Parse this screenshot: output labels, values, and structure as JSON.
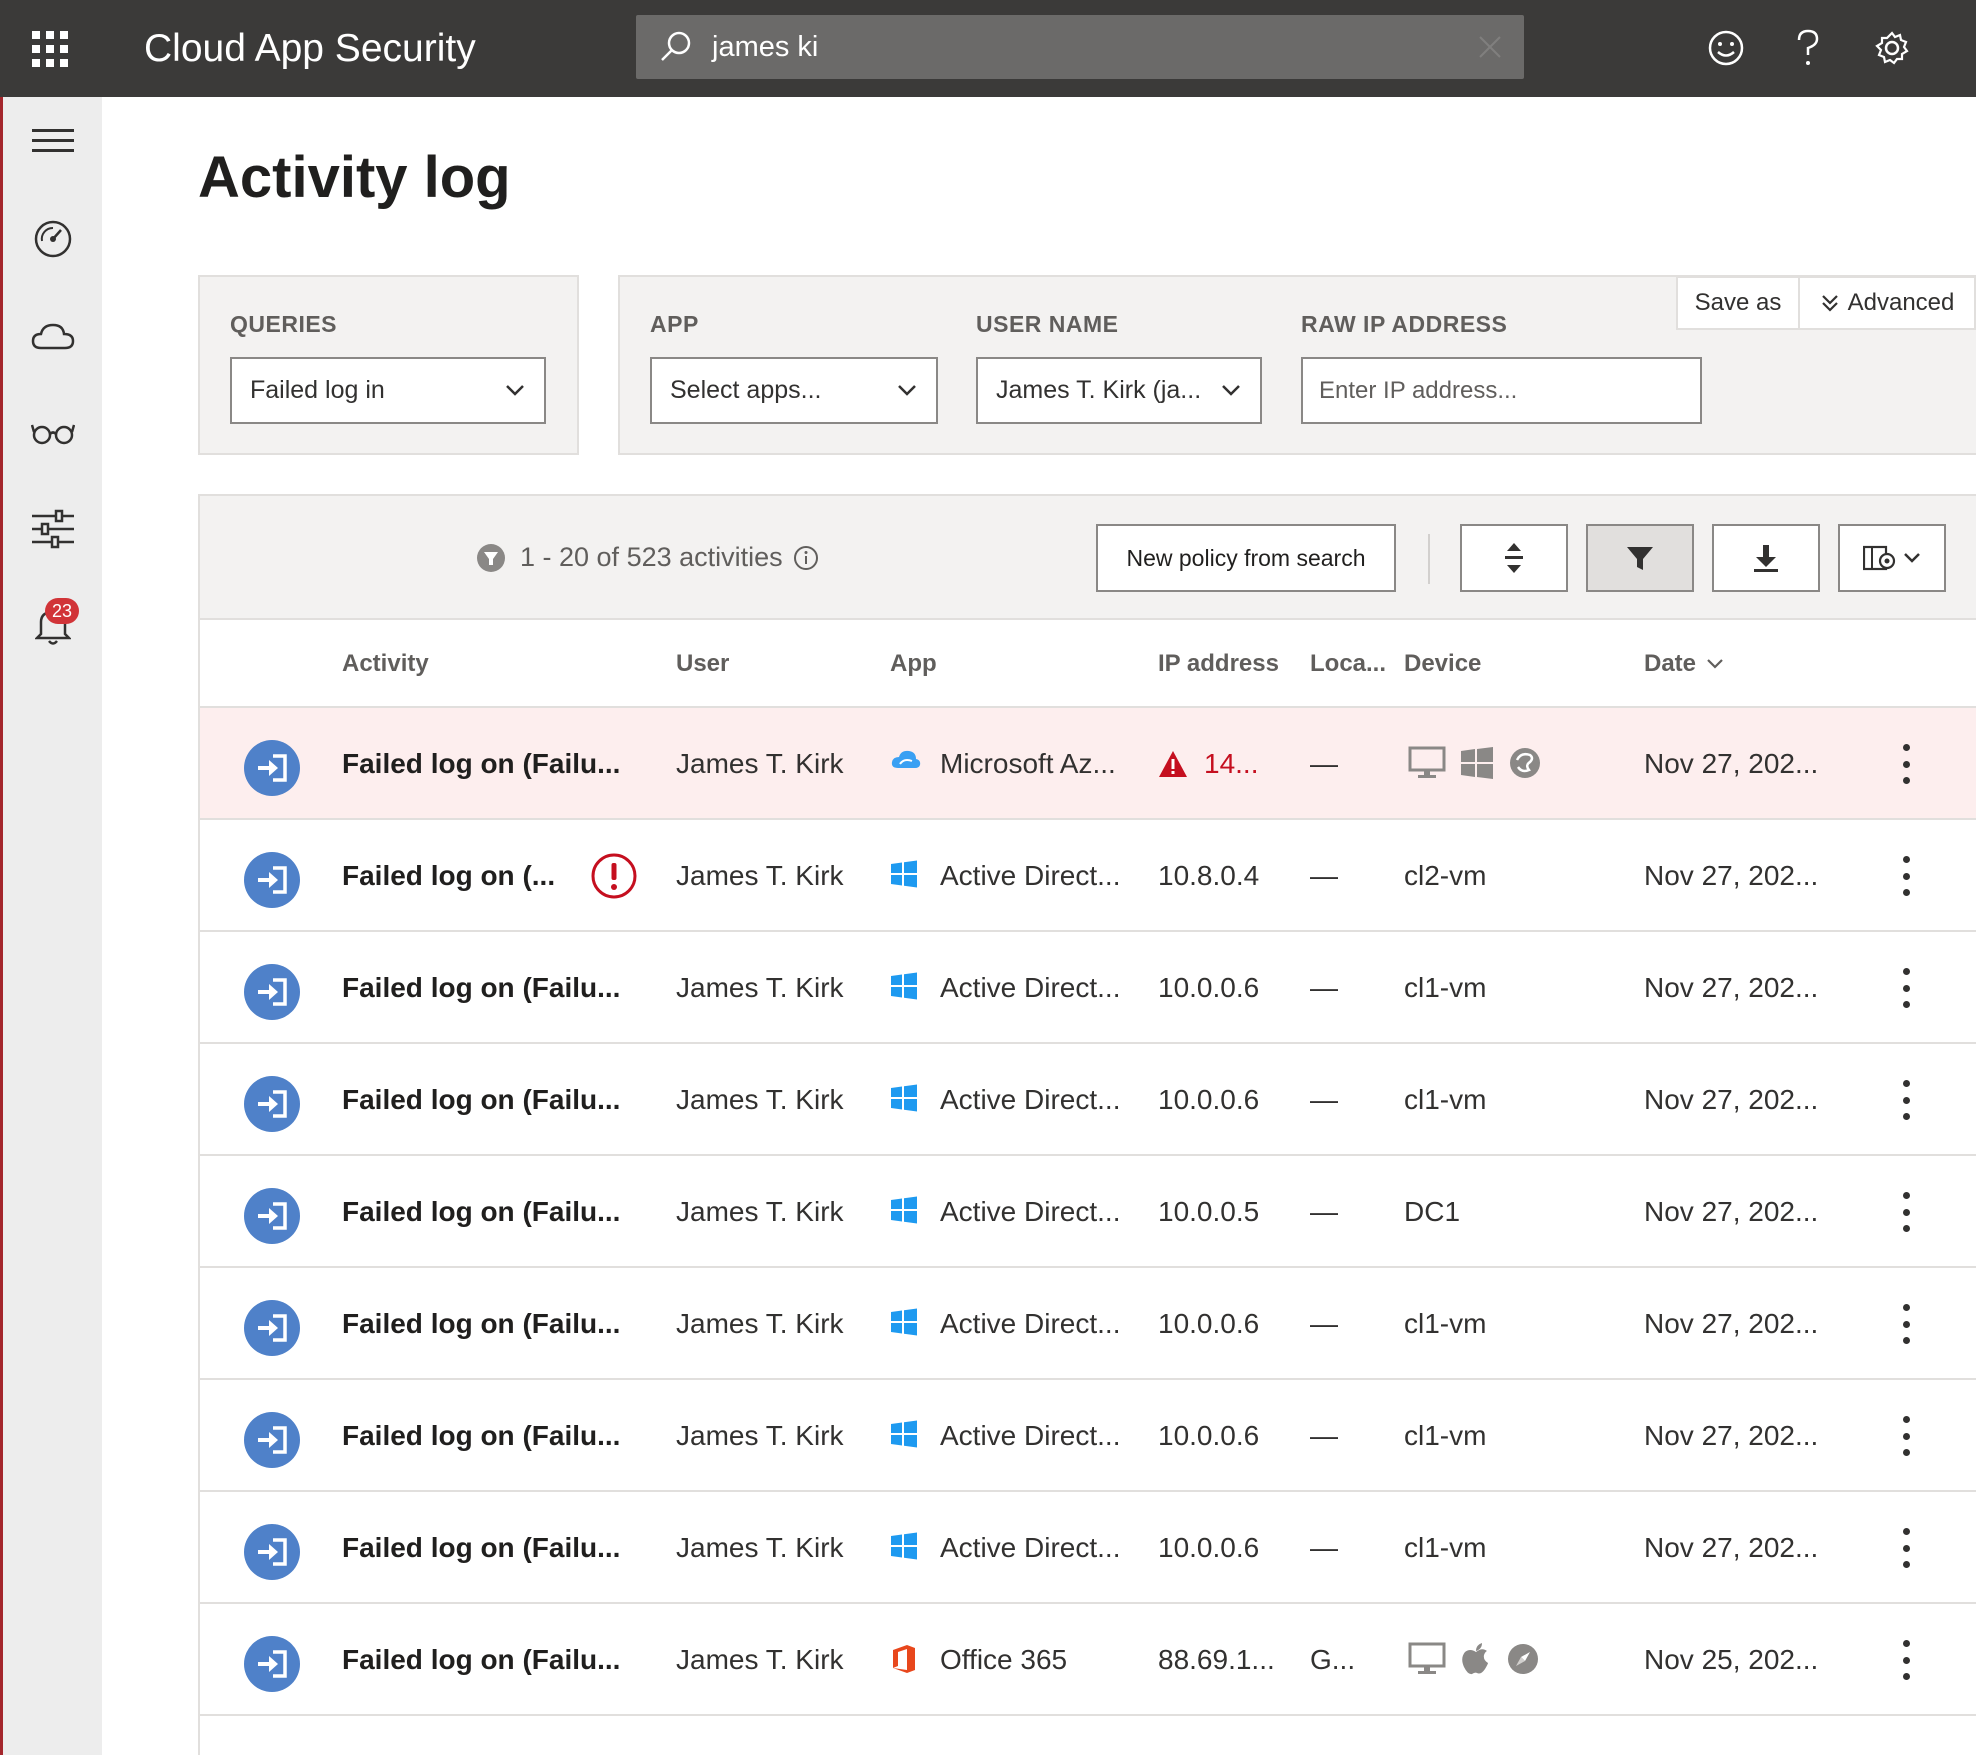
{
  "header": {
    "app_title": "Cloud App Security",
    "search_value": "james ki",
    "icons": [
      "waffle-icon",
      "search-icon",
      "clear-icon",
      "smiley-icon",
      "help-icon",
      "gear-icon"
    ]
  },
  "leftnav": {
    "items": [
      "hamburger-icon",
      "dashboard-icon",
      "cloud-icon",
      "glasses-icon",
      "sliders-icon",
      "bell-icon"
    ],
    "alerts_badge": "23"
  },
  "page": {
    "title": "Activity log"
  },
  "filters": {
    "queries_label": "QUERIES",
    "queries_value": "Failed log in",
    "app_label": "APP",
    "app_value": "Select apps...",
    "user_label": "USER NAME",
    "user_value": "James T. Kirk (ja...",
    "ip_label": "RAW IP ADDRESS",
    "ip_placeholder": "Enter IP address...",
    "save_as": "Save as",
    "advanced": "Advanced"
  },
  "toolbar": {
    "count_text": "1 - 20 of 523 activities",
    "new_policy": "New policy from search"
  },
  "table": {
    "columns": {
      "activity": "Activity",
      "user": "User",
      "app": "App",
      "ip": "IP address",
      "location": "Loca...",
      "device": "Device",
      "date": "Date"
    },
    "rows": [
      {
        "activity": "Failed log on (Failu...",
        "user": "James T. Kirk",
        "app": "Microsoft Az...",
        "app_icon": "azure",
        "ip": "14...",
        "ip_alert": true,
        "location": "—",
        "device": "",
        "device_icons": [
          "desktop-icon",
          "windows-icon",
          "browser-icon"
        ],
        "date": "Nov 27, 202..."
      },
      {
        "activity": "Failed log on (...",
        "user": "James T. Kirk",
        "app": "Active Direct...",
        "app_icon": "windows",
        "ip": "10.8.0.4",
        "location": "—",
        "device": "cl2-vm",
        "date": "Nov 27, 202...",
        "flag": true
      },
      {
        "activity": "Failed log on (Failu...",
        "user": "James T. Kirk",
        "app": "Active Direct...",
        "app_icon": "windows",
        "ip": "10.0.0.6",
        "location": "—",
        "device": "cl1-vm",
        "date": "Nov 27, 202..."
      },
      {
        "activity": "Failed log on (Failu...",
        "user": "James T. Kirk",
        "app": "Active Direct...",
        "app_icon": "windows",
        "ip": "10.0.0.6",
        "location": "—",
        "device": "cl1-vm",
        "date": "Nov 27, 202..."
      },
      {
        "activity": "Failed log on (Failu...",
        "user": "James T. Kirk",
        "app": "Active Direct...",
        "app_icon": "windows",
        "ip": "10.0.0.5",
        "location": "—",
        "device": "DC1",
        "date": "Nov 27, 202..."
      },
      {
        "activity": "Failed log on (Failu...",
        "user": "James T. Kirk",
        "app": "Active Direct...",
        "app_icon": "windows",
        "ip": "10.0.0.6",
        "location": "—",
        "device": "cl1-vm",
        "date": "Nov 27, 202..."
      },
      {
        "activity": "Failed log on (Failu...",
        "user": "James T. Kirk",
        "app": "Active Direct...",
        "app_icon": "windows",
        "ip": "10.0.0.6",
        "location": "—",
        "device": "cl1-vm",
        "date": "Nov 27, 202..."
      },
      {
        "activity": "Failed log on (Failu...",
        "user": "James T. Kirk",
        "app": "Active Direct...",
        "app_icon": "windows",
        "ip": "10.0.0.6",
        "location": "—",
        "device": "cl1-vm",
        "date": "Nov 27, 202..."
      },
      {
        "activity": "Failed log on (Failu...",
        "user": "James T. Kirk",
        "app": "Office 365",
        "app_icon": "office",
        "ip": "88.69.1...",
        "location": "G...",
        "device": "",
        "device_icons": [
          "desktop-icon",
          "apple-icon",
          "safari-icon"
        ],
        "date": "Nov 25, 202..."
      }
    ]
  },
  "colors": {
    "topbar": "#3b3a39",
    "accent_red": "#a4262c",
    "activity_icon": "#4f81c9",
    "alert_row": "#fdeeee",
    "alert_text": "#c50f1f"
  }
}
